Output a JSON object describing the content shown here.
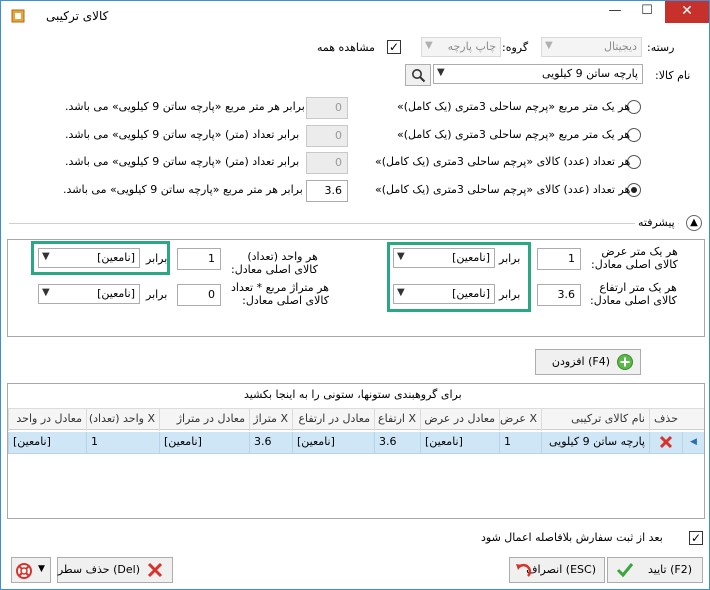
{
  "window": {
    "title": "کالای ترکیبی",
    "close": "✕",
    "maximize": "☐",
    "minimize": "—"
  },
  "filters": {
    "category_label": "رسته:",
    "category_value": "دیجیتال",
    "group_label": "گروه:",
    "group_value": "چاپ پارچه",
    "view_all_label": "مشاهده همه",
    "view_all_checked": true,
    "product_label": "نام کالا:",
    "product_value": "پارچه ساتن 9 کیلویی"
  },
  "options": [
    {
      "label": "هر یک متر مربع «پرچم ساحلی 3متری (یک کامل)»",
      "value": "0",
      "result": "برابر هر متر مربع «پارچه ساتن 9 کیلویی» می باشد.",
      "selected": false,
      "enabled": false
    },
    {
      "label": "هر یک متر مربع «پرچم ساحلی 3متری (یک کامل)»",
      "value": "0",
      "result": "برابر تعداد (متر) «پارچه ساتن 9 کیلویی» می باشد.",
      "selected": false,
      "enabled": false
    },
    {
      "label": "هر تعداد (عدد) کالای «پرچم ساحلی 3متری (یک کامل)»",
      "value": "0",
      "result": "برابر تعداد (متر) «پارچه ساتن 9 کیلویی» می باشد.",
      "selected": false,
      "enabled": false
    },
    {
      "label": "هر تعداد (عدد) کالای «پرچم ساحلی 3متری (یک کامل)»",
      "value": "3.6",
      "result": "برابر هر متر مربع «پارچه ساتن 9 کیلویی» می باشد.",
      "selected": true,
      "enabled": true
    }
  ],
  "advanced": {
    "title": "پیشرفته",
    "width_label": "هر یک متر عرض\nکالای اصلی معادل:",
    "width_value": "1",
    "width_eq": "برابر",
    "width_unit": "[نامعین]",
    "height_label": "هر یک متر ارتفاع\nکالای اصلی معادل:",
    "height_value": "3.6",
    "height_eq": "برابر",
    "height_unit": "[نامعین]",
    "unit_label": "هر واحد (تعداد)\nکالای اصلی معادل:",
    "unit_value": "1",
    "unit_eq": "برابر",
    "unit_unit": "[نامعین]",
    "sqm_label": "هر متراژ مربع * تعداد\nکالای اصلی معادل:",
    "sqm_value": "0",
    "sqm_eq": "برابر",
    "sqm_unit": "[نامعین]"
  },
  "add_button": "(F4) افزودن",
  "grid": {
    "group_hint": "برای گروهبندی ستونها، ستونی را به اینجا بکشید",
    "columns": [
      "حذف",
      "نام کالای ترکیبی",
      "X عرض",
      "معادل در عرض",
      "X ارتفاع",
      "معادل در ارتفاع",
      "X متراژ",
      "معادل در متراژ",
      "X واحد (تعداد)",
      "معادل در واحد"
    ],
    "rows": [
      [
        "",
        "پارچه ساتن 9 کیلویی",
        "1",
        "[نامعین]",
        "3.6",
        "[نامعین]",
        "3.6",
        "[نامعین]",
        "1",
        "[نامعین]"
      ]
    ]
  },
  "apply_after_order": {
    "label": "بعد از ثبت سفارش بلافاصله اعمال شود",
    "checked": true
  },
  "footer": {
    "ok": "(F2) تایید",
    "cancel": "(ESC) انصراف",
    "delete_row": "(Del) حذف سطر"
  },
  "colors": {
    "highlight": "#2aa783",
    "selected_row": "#cfe6f7",
    "close_btn": "#c7312b"
  }
}
